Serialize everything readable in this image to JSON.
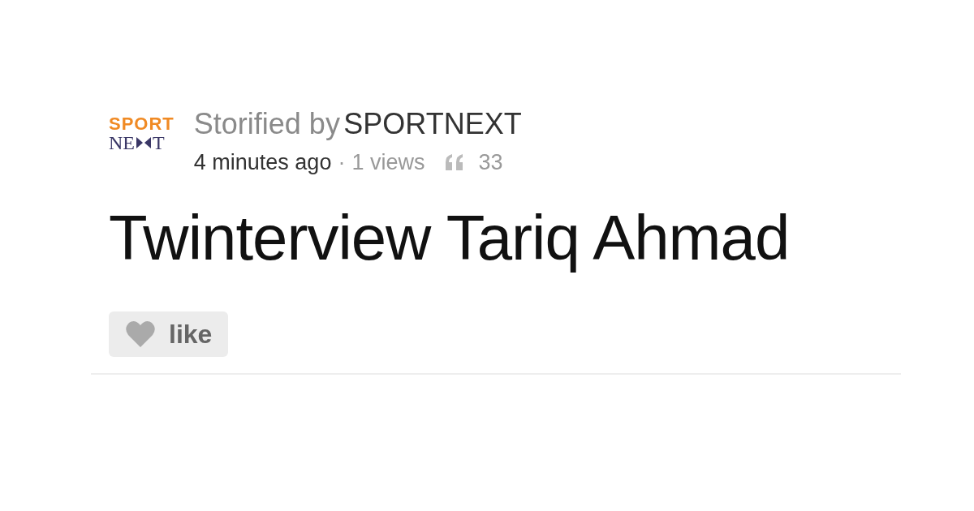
{
  "logo": {
    "top": "SPORT",
    "bottom_start": "NE",
    "bottom_end": "T"
  },
  "byline": {
    "prefix": "Storified by",
    "author": "SPORTNEXT"
  },
  "meta": {
    "time": "4 minutes ago",
    "separator": "·",
    "views": "1 views",
    "quotes": "33"
  },
  "title": "Twinterview Tariq Ahmad",
  "like_button": {
    "label": "like",
    "liked": false
  }
}
